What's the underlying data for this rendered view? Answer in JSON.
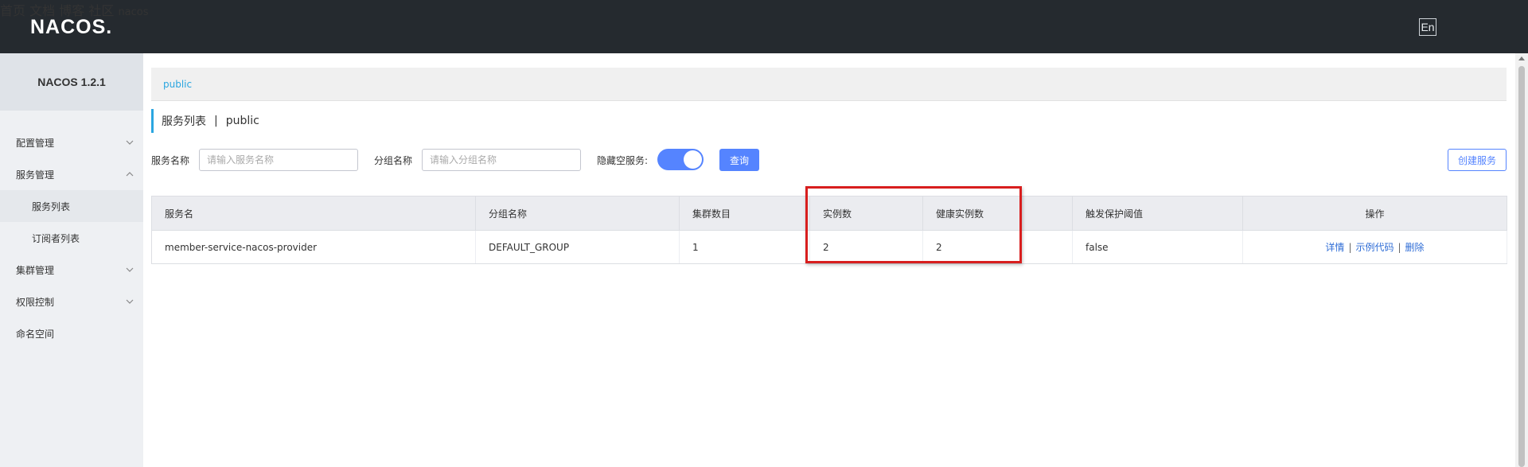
{
  "header": {
    "logo": "NACOS.",
    "nav": [
      "首页",
      "文档",
      "博客",
      "社区"
    ],
    "lang": "En",
    "user": "nacos"
  },
  "sidebar": {
    "version": "NACOS 1.2.1",
    "items": [
      {
        "label": "配置管理",
        "chevron": "down"
      },
      {
        "label": "服务管理",
        "chevron": "up"
      },
      {
        "label": "服务列表",
        "sub": true,
        "active": true
      },
      {
        "label": "订阅者列表",
        "sub": true
      },
      {
        "label": "集群管理",
        "chevron": "down"
      },
      {
        "label": "权限控制",
        "chevron": "down"
      },
      {
        "label": "命名空间"
      }
    ]
  },
  "breadcrumb": {
    "namespace": "public"
  },
  "title": {
    "main": "服务列表",
    "separator": "|",
    "namespace": "public"
  },
  "filters": {
    "service_name_label": "服务名称",
    "service_name_placeholder": "请输入服务名称",
    "group_name_label": "分组名称",
    "group_name_placeholder": "请输入分组名称",
    "hide_empty_label": "隐藏空服务:",
    "hide_empty_on": true,
    "query_button": "查询",
    "create_button": "创建服务"
  },
  "table": {
    "headers": [
      "服务名",
      "分组名称",
      "集群数目",
      "实例数",
      "健康实例数",
      "触发保护阈值",
      "操作"
    ],
    "rows": [
      {
        "service": "member-service-nacos-provider",
        "group": "DEFAULT_GROUP",
        "clusters": "1",
        "instances": "2",
        "healthy": "2",
        "threshold": "false",
        "ops": [
          "详情",
          "示例代码",
          "删除"
        ]
      }
    ],
    "ops_separator": "|"
  },
  "colors": {
    "header_bg": "#252a2f",
    "accent": "#5584ff",
    "link": "#2f6dd6",
    "breadcrumb": "#2aa6e0",
    "highlight_box": "#d81e1e"
  }
}
